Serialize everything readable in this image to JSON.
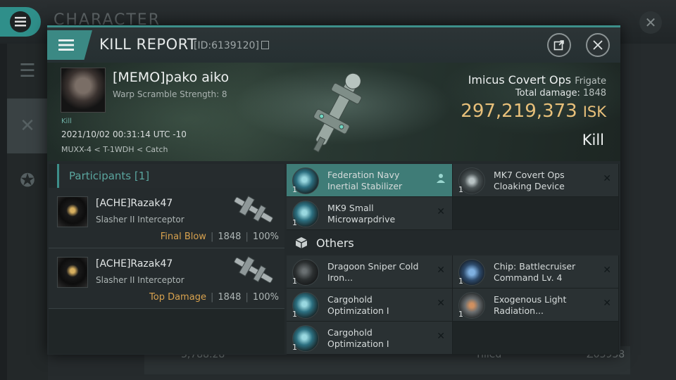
{
  "background": {
    "title": "CHARACTER",
    "bottom_row": {
      "value": "3,788.28",
      "label": "Tilled",
      "code": "Z03938"
    }
  },
  "modal": {
    "title": "KILL REPORT",
    "id_text": "[ID:6139120]",
    "accent_color": "#3d8f8a"
  },
  "victim": {
    "name": "[MEMO]pako aiko",
    "warp_scramble": "Warp Scramble Strength: 8",
    "kill_tag": "Kill",
    "datetime": "2021/10/02 00:31:14 UTC -10",
    "location": "MUXX-4 < T-1WDH < Catch",
    "ship_name": "Imicus Covert Ops",
    "ship_class": "Frigate",
    "total_damage_label": "Total damage:",
    "total_damage": "1848",
    "isk_value": "297,219,373",
    "isk_unit": "ISK",
    "result": "Kill"
  },
  "participants": {
    "header": "Participants [1]",
    "rows": [
      {
        "name": "[ACHE]Razak47",
        "ship": "Slasher II Interceptor",
        "tag": "Final Blow",
        "damage": "1848",
        "percent": "100%"
      },
      {
        "name": "[ACHE]Razak47",
        "ship": "Slasher II Interceptor",
        "tag": "Top Damage",
        "damage": "1848",
        "percent": "100%"
      }
    ]
  },
  "items": {
    "fitted": [
      {
        "qty": "1",
        "line1": "Federation Navy",
        "line2": "Inertial Stabilizer",
        "icon": "stabilizer-icon",
        "highlight": true
      },
      {
        "qty": "1",
        "line1": "MK7 Covert Ops",
        "line2": "Cloaking Device",
        "icon": "cloak-icon"
      },
      {
        "qty": "1",
        "line1": "MK9 Small",
        "line2": "Microwarpdrive",
        "icon": "mwd-icon"
      }
    ],
    "others_label": "Others",
    "others": [
      {
        "qty": "1",
        "line1": "Dragoon Sniper Cold",
        "line2": "Iron...",
        "icon": "drone-icon"
      },
      {
        "qty": "1",
        "line1": "Chip: Battlecruiser",
        "line2": "Command Lv. 4",
        "icon": "chip-icon"
      },
      {
        "qty": "1",
        "line1": "Cargohold",
        "line2": "Optimization I",
        "icon": "cargohold-icon"
      },
      {
        "qty": "1",
        "line1": "Exogenous Light",
        "line2": "Radiation...",
        "icon": "radiation-icon"
      },
      {
        "qty": "1",
        "line1": "Cargohold",
        "line2": "Optimization I",
        "icon": "cargohold-icon"
      }
    ]
  }
}
